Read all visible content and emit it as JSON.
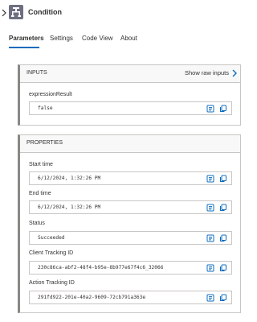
{
  "header": {
    "title": "Condition",
    "expand_icon": "chevron-right-icon",
    "action_icon": "condition-icon"
  },
  "tabs": [
    {
      "label": "Parameters",
      "active": true
    },
    {
      "label": "Settings",
      "active": false
    },
    {
      "label": "Code View",
      "active": false
    },
    {
      "label": "About",
      "active": false
    }
  ],
  "inputs": {
    "heading": "INPUTS",
    "raw_link": "Show raw inputs",
    "fields": [
      {
        "label": "expressionResult",
        "value": "false"
      }
    ]
  },
  "properties": {
    "heading": "PROPERTIES",
    "fields": [
      {
        "label": "Start time",
        "value": "6/12/2024, 1:32:26 PM"
      },
      {
        "label": "End time",
        "value": "6/12/2024, 1:32:26 PM"
      },
      {
        "label": "Status",
        "value": "Succeeded"
      },
      {
        "label": "Client Tracking ID",
        "value": "230c86ca-abf2-48f4-b95e-8b977e67f4c6_32066"
      },
      {
        "label": "Action Tracking ID",
        "value": "291fd922-201e-40a2-9609-72cb791a363e"
      }
    ]
  },
  "colors": {
    "accent": "#0f6cbd",
    "border": "#c8c6c4",
    "icon": "#0f6cbd"
  }
}
